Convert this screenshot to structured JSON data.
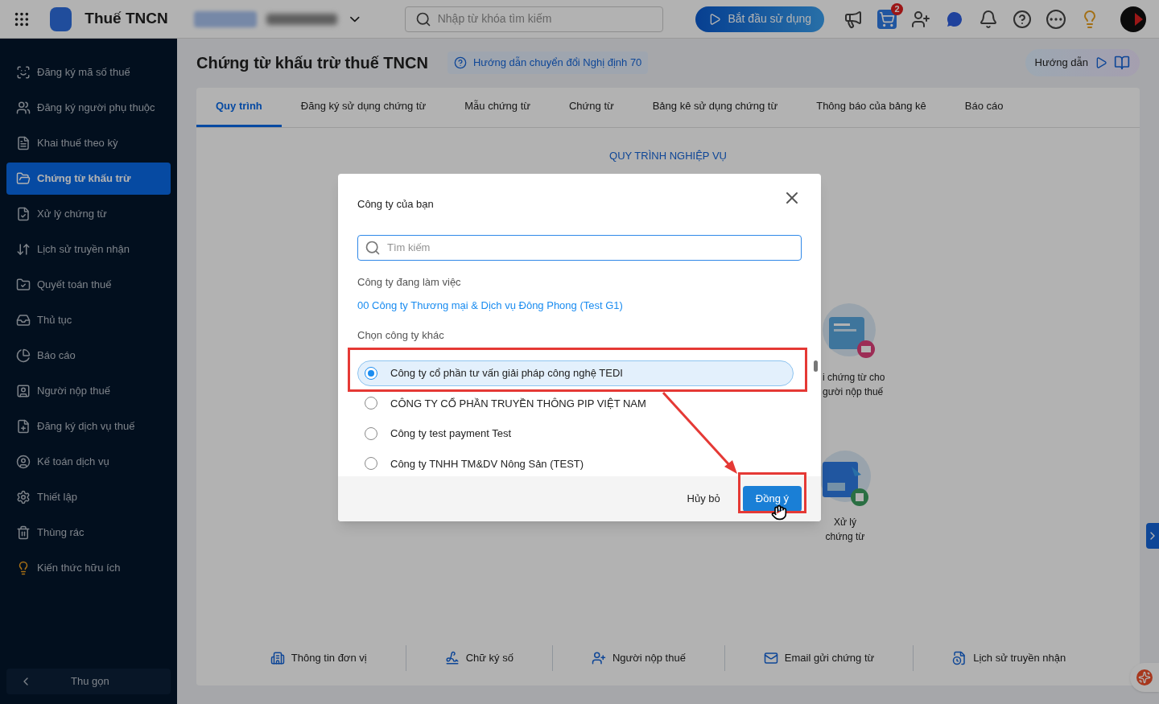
{
  "header": {
    "app_title": "Thuế TNCN",
    "search_placeholder": "Nhập từ khóa tìm kiếm",
    "start_button": "Bắt đầu sử dụng",
    "cart_badge": "2"
  },
  "sidebar": {
    "items": [
      {
        "label": "Đăng ký mã số thuế",
        "selected": false
      },
      {
        "label": "Đăng ký người phụ thuộc",
        "selected": false
      },
      {
        "label": "Khai thuế theo kỳ",
        "selected": false
      },
      {
        "label": "Chứng từ khấu trừ",
        "selected": true
      },
      {
        "label": "Xử lý chứng từ",
        "selected": false
      },
      {
        "label": "Lịch sử truyền nhận",
        "selected": false
      },
      {
        "label": "Quyết toán thuế",
        "selected": false
      },
      {
        "label": "Thủ tục",
        "selected": false
      },
      {
        "label": "Báo cáo",
        "selected": false
      },
      {
        "label": "Người nộp thuế",
        "selected": false
      },
      {
        "label": "Đăng ký dịch vụ thuế",
        "selected": false
      },
      {
        "label": "Kế toán dịch vụ",
        "selected": false
      },
      {
        "label": "Thiết lập",
        "selected": false
      },
      {
        "label": "Thùng rác",
        "selected": false
      },
      {
        "label": "Kiến thức hữu ích",
        "selected": false
      }
    ],
    "collapse": "Thu gọn"
  },
  "page_title": "Chứng từ khấu trừ thuế TNCN",
  "guide_link": "Hướng dẫn chuyển đổi Nghị định 70",
  "help_button": "Hướng dẫn",
  "tabs": [
    {
      "label": "Quy trình",
      "selected": true
    },
    {
      "label": "Đăng ký sử dụng chứng từ",
      "selected": false
    },
    {
      "label": "Mẫu chứng từ",
      "selected": false
    },
    {
      "label": "Chứng từ",
      "selected": false
    },
    {
      "label": "Bảng kê sử dụng chứng từ",
      "selected": false
    },
    {
      "label": "Thông báo của bảng kê",
      "selected": false
    },
    {
      "label": "Báo cáo",
      "selected": false
    }
  ],
  "process": {
    "heading": "QUY TRÌNH NGHIỆP VỤ",
    "steps": [
      {
        "lines": [
          "i chứng từ cho",
          "gười nộp thuế"
        ]
      },
      {
        "lines": [
          "Xử lý",
          "chứng từ"
        ]
      }
    ]
  },
  "dialog": {
    "title": "Công ty của bạn",
    "search_placeholder": "Tìm kiếm",
    "current_label": "Công ty đang làm việc",
    "current_company": "00 Công ty Thương mại & Dịch vụ Đông Phong (Test G1)",
    "other_label": "Chọn công ty khác",
    "companies": [
      {
        "name": "Công ty cổ phần tư vấn giải pháp công nghệ TEDI",
        "selected": true
      },
      {
        "name": "CÔNG TY CỔ PHẦN TRUYỀN THÔNG PIP VIỆT NAM",
        "selected": false
      },
      {
        "name": "Công ty test payment Test",
        "selected": false
      },
      {
        "name": "Công ty TNHH TM&DV Nông Sản (TEST)",
        "selected": false
      }
    ],
    "cancel": "Hủy bỏ",
    "confirm": "Đồng ý"
  },
  "quick_links": [
    "Thông tin đơn vị",
    "Chữ ký số",
    "Người nộp thuế",
    "Email gửi chứng từ",
    "Lịch sử truyền nhận"
  ]
}
